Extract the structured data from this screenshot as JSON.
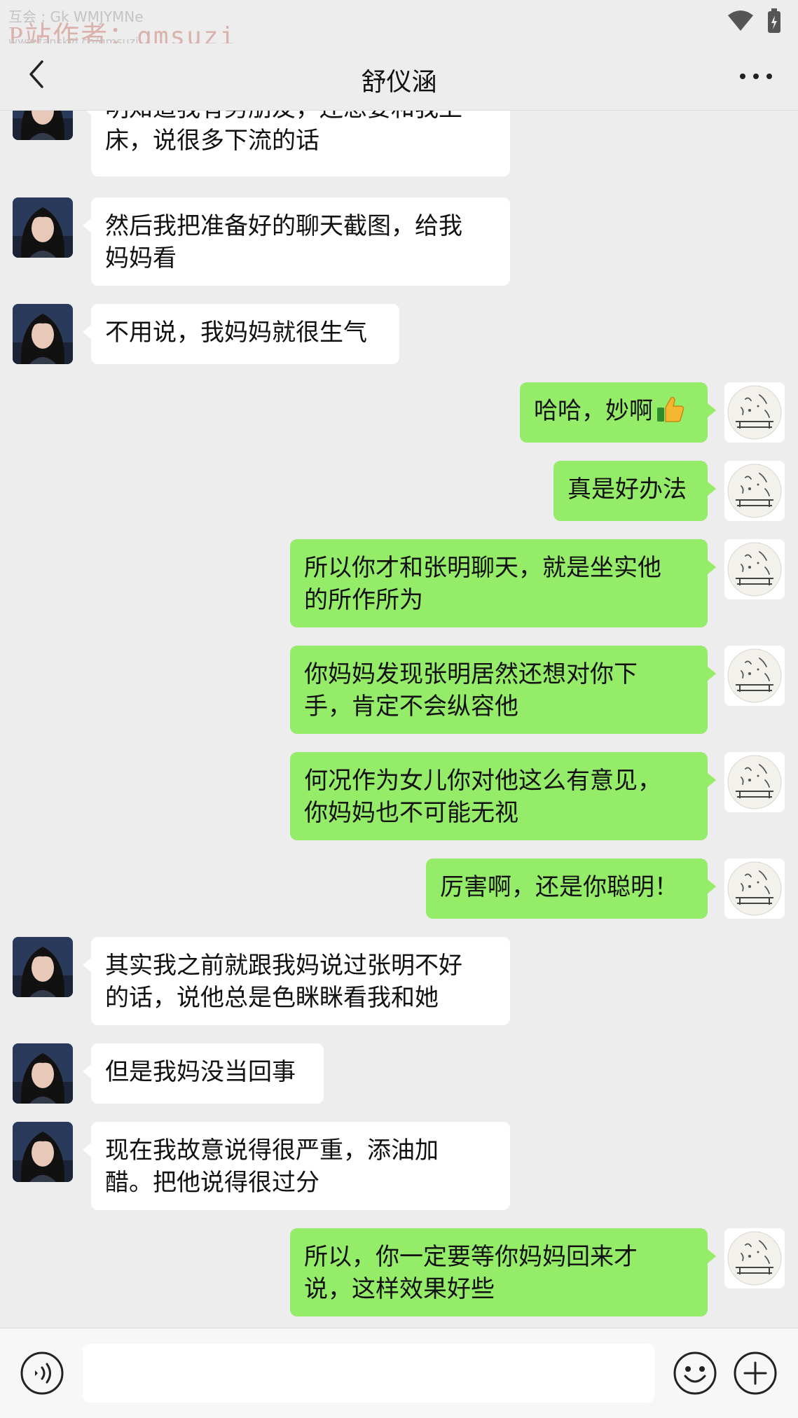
{
  "status_bar": {
    "watermark_top": "互会 : Gk WMJYMNe",
    "watermark_label": "P站作者：",
    "watermark_author": "qmsuzi",
    "watermark_url": "www.fanskyi.co/qmsuzi",
    "icons": [
      "wifi-icon",
      "battery-icon"
    ]
  },
  "header": {
    "title": "舒仪涵",
    "back_icon": "chevron-left-icon",
    "more_icon": "more-dots-icon"
  },
  "messages": [
    {
      "side": "in",
      "text": "明知道我有男朋友，还想要和我上\n床，说很多下流的话"
    },
    {
      "side": "in",
      "text": "然后我把准备好的聊天截图，给我\n妈妈看"
    },
    {
      "side": "in",
      "text": "不用说，我妈妈就很生气"
    },
    {
      "side": "out",
      "text": "哈哈，妙啊",
      "emoji": "thumbs-up-icon"
    },
    {
      "side": "out",
      "text": "真是好办法"
    },
    {
      "side": "out",
      "text": "所以你才和张明聊天，就是坐实他\n的所作所为"
    },
    {
      "side": "out",
      "text": "你妈妈发现张明居然还想对你下\n手，肯定不会纵容他"
    },
    {
      "side": "out",
      "text": "何况作为女儿你对他这么有意见，\n你妈妈也不可能无视"
    },
    {
      "side": "out",
      "text": "厉害啊，还是你聪明！"
    },
    {
      "side": "in",
      "text": "其实我之前就跟我妈说过张明不好\n的话，说他总是色眯眯看我和她"
    },
    {
      "side": "in",
      "text": "但是我妈没当回事"
    },
    {
      "side": "in",
      "text": "现在我故意说得很严重，添油加\n醋。把他说得很过分"
    },
    {
      "side": "out",
      "text": "所以，你一定要等你妈妈回来才\n说，这样效果好些"
    }
  ],
  "input_bar": {
    "placeholder": "",
    "voice_icon": "voice-icon",
    "emoji_icon": "emoji-icon",
    "plus_icon": "plus-icon"
  },
  "colors": {
    "background": "#ededed",
    "bubble_in": "#ffffff",
    "bubble_out": "#95ec69"
  }
}
